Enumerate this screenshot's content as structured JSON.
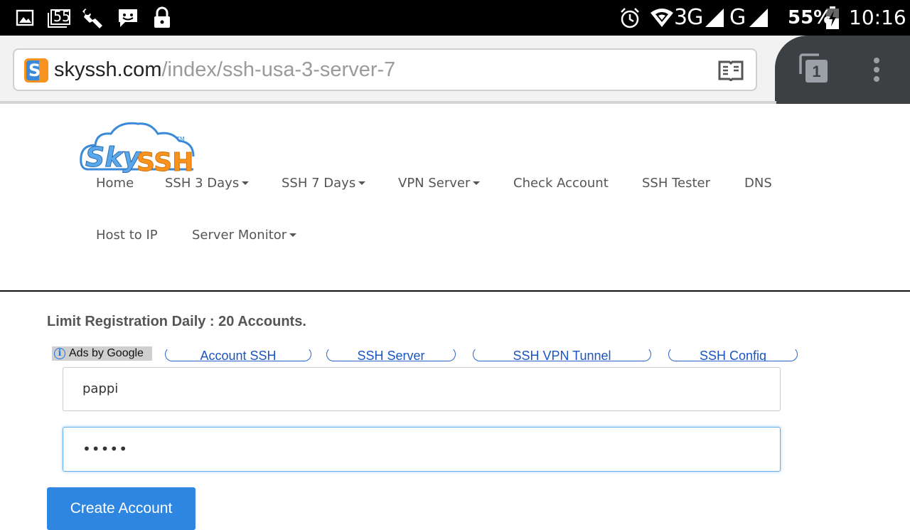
{
  "status_bar": {
    "left_icons": [
      "image-icon",
      "notification-55-icon",
      "wrench-icon",
      "chat-icon",
      "lock-icon"
    ],
    "notification_count": "55",
    "network_3g": "3G",
    "network_g": "G",
    "battery": "55%",
    "time": "10:16"
  },
  "browser": {
    "url_domain": "skyssh.com",
    "url_path": "/index/ssh-usa-3-server-7",
    "tab_count": "1",
    "site_icon_letter": "S"
  },
  "page": {
    "nav": [
      {
        "label": "Home",
        "dropdown": false
      },
      {
        "label": "SSH 3 Days",
        "dropdown": true
      },
      {
        "label": "SSH 7 Days",
        "dropdown": true
      },
      {
        "label": "VPN Server",
        "dropdown": true
      },
      {
        "label": "Check Account",
        "dropdown": false
      },
      {
        "label": "SSH Tester",
        "dropdown": false
      },
      {
        "label": "DNS",
        "dropdown": false
      },
      {
        "label": "Host to IP",
        "dropdown": false
      },
      {
        "label": "Server Monitor",
        "dropdown": true
      }
    ],
    "limit_text": "Limit Registration Daily : 20 Accounts.",
    "ads_label": "Ads by Google",
    "ad_links": [
      "Account SSH",
      "SSH Server",
      "SSH VPN Tunnel",
      "SSH Config"
    ],
    "username_value": "pappi",
    "password_value": "•••••",
    "create_button": "Create Account"
  },
  "colors": {
    "link_blue": "#1a55c6",
    "button_blue": "#2f86e0",
    "focus_border": "#66afe9",
    "logo_blue": "#3b8ad9",
    "logo_orange": "#f7931e"
  }
}
